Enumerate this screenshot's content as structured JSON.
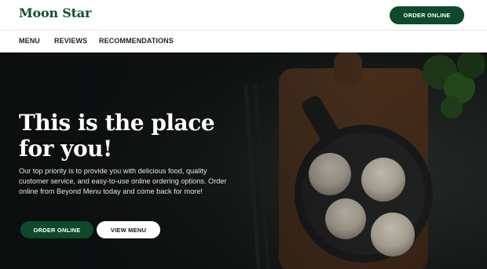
{
  "header": {
    "logo": "Moon Star",
    "order_button": "ORDER ONLINE"
  },
  "nav": {
    "items": [
      "MENU",
      "REVIEWS",
      "RECOMMENDATIONS"
    ]
  },
  "hero": {
    "title": "This is the place for you!",
    "text": "Our top priority is to provide you with delicious food, quality customer service, and easy-to-use online ordering options. Order online from Beyond Menu today and come back for more!",
    "order_button": "ORDER ONLINE",
    "menu_button": "VIEW MENU"
  },
  "colors": {
    "brand_green": "#0c4a2b",
    "logo_green": "#12502f"
  }
}
